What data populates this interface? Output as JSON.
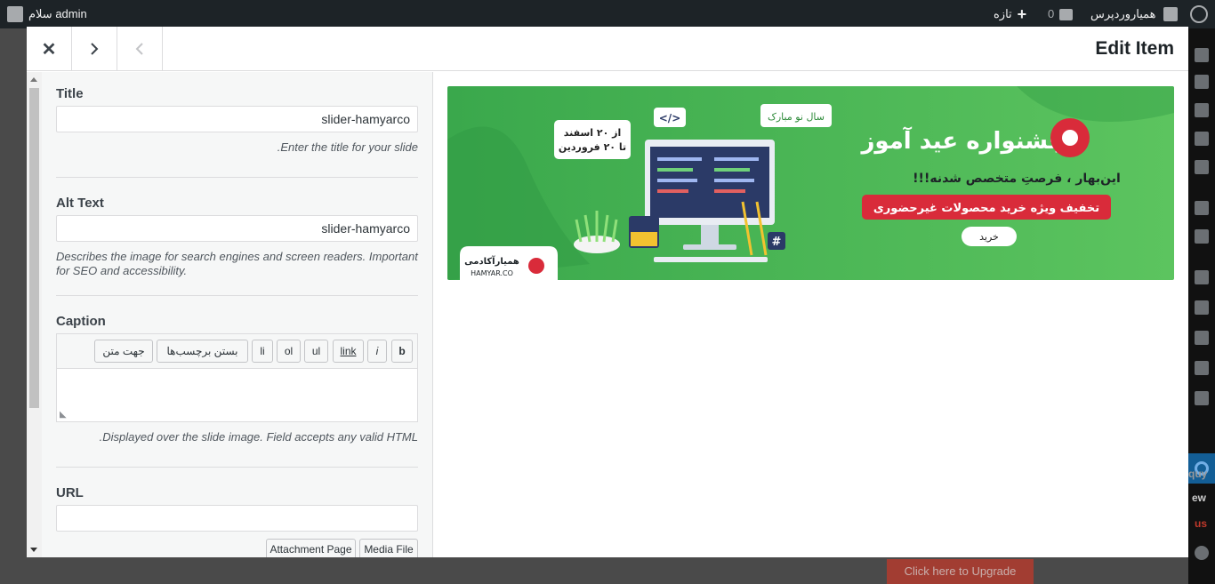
{
  "adminbar": {
    "greeting": "سلام admin",
    "site_name": "همیاروردپرس",
    "comments_count": "0",
    "new_label": "تازه"
  },
  "background": {
    "upgrade_label": "Click here to Upgrade",
    "frag_1": "quy",
    "frag_2": "ew",
    "frag_3": "us"
  },
  "modal": {
    "title": "Edit Item",
    "close_icon": "close-icon",
    "next_icon": "chevron-right-icon",
    "prev_icon": "chevron-left-icon"
  },
  "fields": {
    "title": {
      "label": "Title",
      "value": "slider-hamyarco",
      "help": "Enter the title for your slide."
    },
    "alt": {
      "label": "Alt Text",
      "value": "slider-hamyarco",
      "help": "Describes the image for search engines and screen readers. Important for SEO and accessibility."
    },
    "caption": {
      "label": "Caption",
      "value": "",
      "help": "Displayed over the slide image. Field accepts any valid HTML."
    },
    "url": {
      "label": "URL",
      "value": ""
    }
  },
  "quicktags": {
    "b": "b",
    "i": "i",
    "link": "link",
    "ul": "ul",
    "ol": "ol",
    "li": "li",
    "close_tags": "بستن برچسب‌ها",
    "direction": "جهت متن"
  },
  "url_buttons": {
    "attachment": "Attachment Page",
    "media": "Media File"
  },
  "banner": {
    "headline": "جشنواره عید آموز",
    "subtitle": "این‌بهار ، فرصتِ متخصص شدنه!!!",
    "offer": "تخفیف ویژه خرید محصولات غیرحضوری",
    "buy": "خرید",
    "tag": "سال نو مبارک",
    "date_1": "از ۲۰ اسفند",
    "date_2": "تا ۲۰ فروردین",
    "brand_fa": "همیارآکادمی",
    "brand_en": "HAMYAR.CO",
    "code_tag": "</>",
    "hash_tag": "#",
    "colors": {
      "green": "#4cb85a",
      "red": "#d92b3a",
      "navy": "#2b3a67"
    }
  }
}
